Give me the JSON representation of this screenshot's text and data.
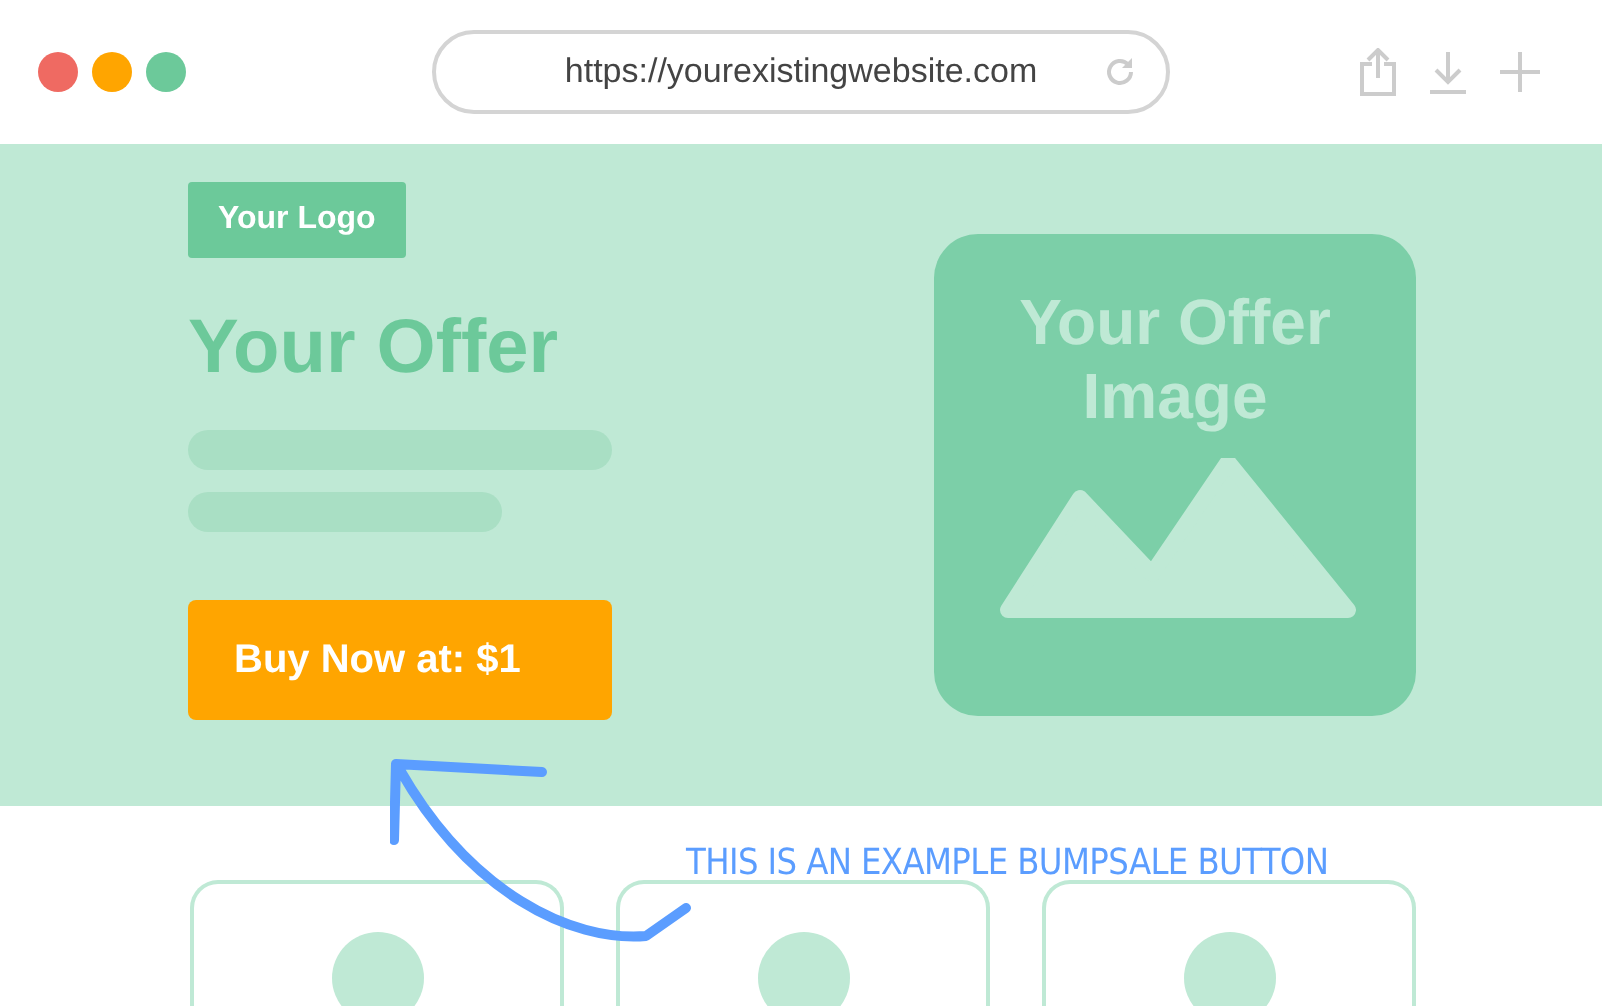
{
  "browser": {
    "url": "https://yourexistingwebsite.com"
  },
  "hero": {
    "logo": "Your Logo",
    "title": "Your Offer",
    "button": "Buy Now at: $1",
    "image_label": "Your Offer Image"
  },
  "annotation": "THIS IS AN EXAMPLE BUMPSALE BUTTON",
  "cards": [
    {
      "kind": "placeholder"
    },
    {
      "kind": "placeholder"
    },
    {
      "kind": "placeholder"
    }
  ]
}
